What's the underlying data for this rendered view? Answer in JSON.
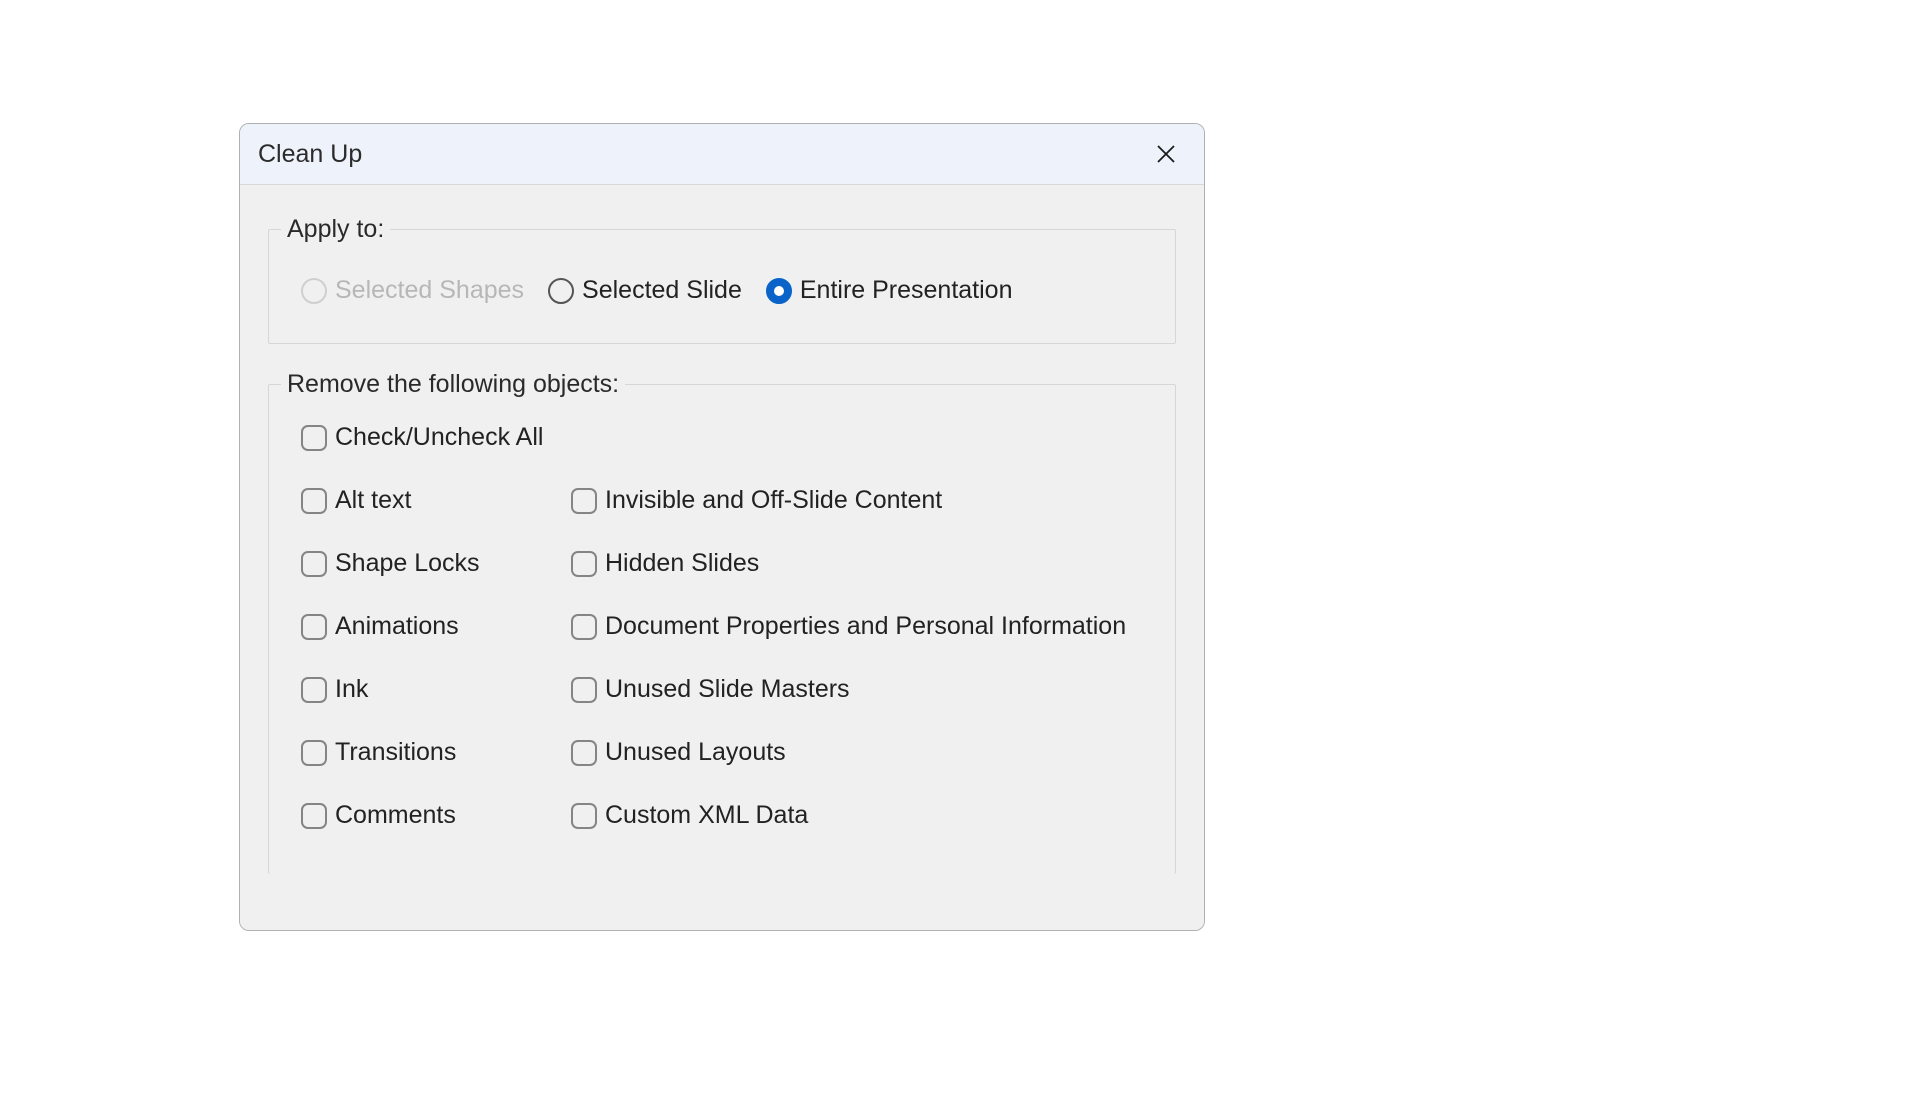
{
  "dialog": {
    "title": "Clean Up"
  },
  "applyTo": {
    "legend": "Apply to:",
    "options": {
      "selectedShapes": {
        "label": "Selected Shapes",
        "disabled": true,
        "selected": false
      },
      "selectedSlide": {
        "label": "Selected Slide",
        "disabled": false,
        "selected": false
      },
      "entirePresentation": {
        "label": "Entire Presentation",
        "disabled": false,
        "selected": true
      }
    }
  },
  "remove": {
    "legend": "Remove the following objects:",
    "checkAllLabel": "Check/Uncheck All",
    "left": [
      "Alt text",
      "Shape Locks",
      "Animations",
      "Ink",
      "Transitions",
      "Comments"
    ],
    "right": [
      "Invisible and Off-Slide Content",
      "Hidden Slides",
      "Document Properties and Personal Information",
      "Unused Slide Masters",
      "Unused Layouts",
      "Custom XML Data"
    ]
  }
}
